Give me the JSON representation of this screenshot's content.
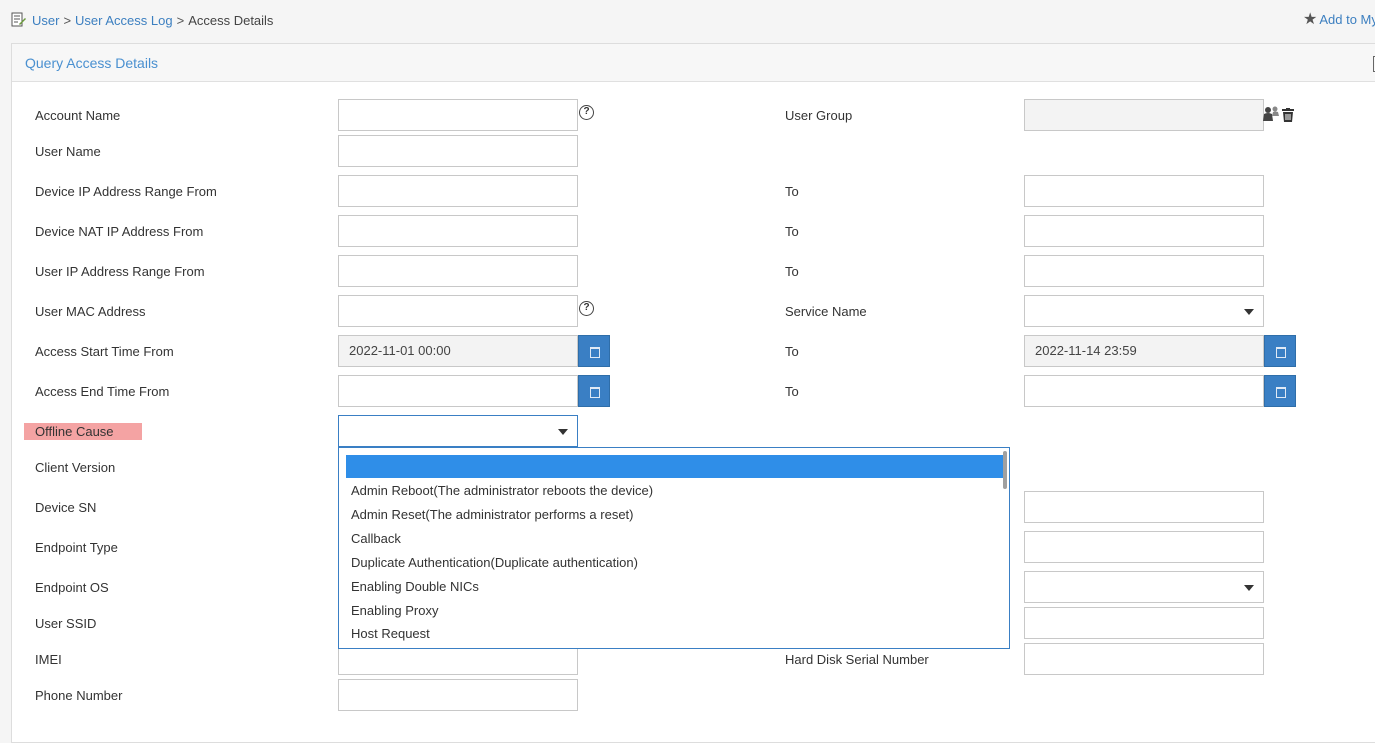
{
  "breadcrumb": {
    "root": "User",
    "sep": ">",
    "log": "User Access Log",
    "current": "Access Details"
  },
  "favorite": {
    "label": "Add to My"
  },
  "panel": {
    "title": "Query Access Details"
  },
  "form": {
    "account_name": {
      "label": "Account Name",
      "value": ""
    },
    "user_group": {
      "label": "User Group",
      "value": ""
    },
    "user_name": {
      "label": "User Name",
      "value": ""
    },
    "device_ip_from": {
      "label": "Device IP Address Range From",
      "value": ""
    },
    "device_ip_to": {
      "label": "To",
      "value": ""
    },
    "device_nat_from": {
      "label": "Device NAT IP Address From",
      "value": ""
    },
    "device_nat_to": {
      "label": "To",
      "value": ""
    },
    "user_ip_from": {
      "label": "User IP Address Range From",
      "value": ""
    },
    "user_ip_to": {
      "label": "To",
      "value": ""
    },
    "user_mac": {
      "label": "User MAC Address",
      "value": ""
    },
    "service_name": {
      "label": "Service Name",
      "value": ""
    },
    "access_start_from": {
      "label": "Access Start Time From",
      "value": "2022-11-01 00:00"
    },
    "access_start_to": {
      "label": "To",
      "value": "2022-11-14 23:59"
    },
    "access_end_from": {
      "label": "Access End Time From",
      "value": ""
    },
    "access_end_to": {
      "label": "To",
      "value": ""
    },
    "offline_cause": {
      "label": "Offline Cause",
      "value": ""
    },
    "client_version": {
      "label": "Client Version"
    },
    "device_sn": {
      "label": "Device SN"
    },
    "endpoint_type": {
      "label": "Endpoint Type"
    },
    "endpoint_os": {
      "label": "Endpoint OS"
    },
    "user_ssid": {
      "label": "User SSID"
    },
    "imei": {
      "label": "IMEI",
      "value": ""
    },
    "hdd_serial": {
      "label": "Hard Disk Serial Number",
      "value": ""
    },
    "phone_number": {
      "label": "Phone Number",
      "value": ""
    }
  },
  "offline_cause_options": [
    "",
    "Admin Reboot(The administrator reboots the device)",
    "Admin Reset(The administrator performs a reset)",
    "Callback",
    "Duplicate Authentication(Duplicate authentication)",
    "Enabling Double NICs",
    "Enabling Proxy",
    "Host Request"
  ],
  "icons": {
    "breadcrumb": "document-icon",
    "favorite": "star-add-icon",
    "help": "question-circle-icon",
    "user_group_select": "user-group-icon",
    "clear": "trash-icon",
    "calendar": "calendar-icon",
    "select_caret": "caret-down-icon"
  },
  "colors": {
    "link": "#3c7fc0",
    "accent": "#3a7fc4",
    "highlight": "#f4a3a3",
    "selected_option": "#2f8ee8"
  }
}
